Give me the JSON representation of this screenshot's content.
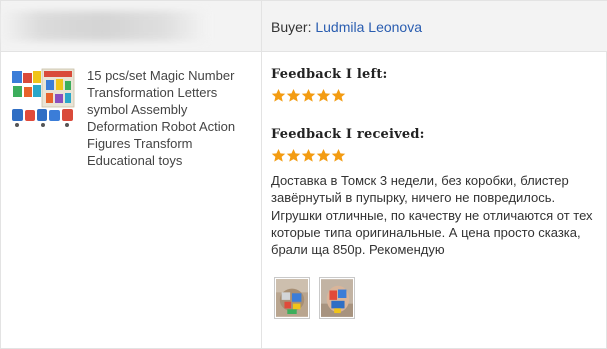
{
  "buyer": {
    "prefix": "Buyer: ",
    "name": "Ludmila Leonova"
  },
  "product": {
    "title": "15 pcs/set Magic Number Transformation Letters symbol Assembly Deformation Robot Action Figures Transform Educational toys",
    "thumbnail_icon": "robot-toy-set-image"
  },
  "feedback_left": {
    "heading": "Feedback I left:",
    "stars": 5
  },
  "feedback_received": {
    "heading": "Feedback I received:",
    "stars": 5,
    "text": "Доставка в Томск 3 недели, без коробки, блистер завёрнутый в пупырку, ничего не повредилось. Игрушки отличные, по качеству не отличаются от тех которые типа оригинальные. А цена просто сказка, брали ща 850р. Рекомендую"
  },
  "photos": [
    "review-photo-1",
    "review-photo-2"
  ],
  "colors": {
    "star": "#f39c12",
    "link": "#2a5db0",
    "header_bg": "#f3f3f3",
    "border": "#e3e3e3"
  }
}
